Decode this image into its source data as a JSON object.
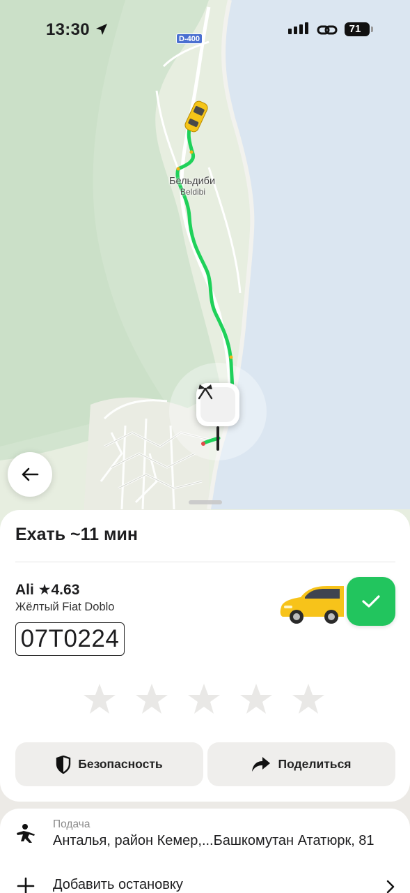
{
  "status_bar": {
    "time": "13:30",
    "battery": "71"
  },
  "map": {
    "road_badge": "D-400",
    "town_name_ru": "Бельдиби",
    "town_name_en": "Beldibi",
    "colors": {
      "land": "#e6eddf",
      "forest": "#cfe2cc",
      "sea": "#dbe6f1",
      "route": "#1fd15a"
    }
  },
  "trip": {
    "eta_title": "Ехать ~11 мин",
    "driver_line": "Ali ★4.63",
    "car_desc": "Жёлтый Fiat Doblo",
    "plate": "07T0224",
    "rating_stars": 5,
    "safety_label": "Безопасность",
    "share_label": "Поделиться"
  },
  "route": {
    "pickup_label": "Подача",
    "pickup_address": "Анталья, район Кемер,...Башкомутан Ататюрк, 81",
    "add_stop_label": "Добавить остановку"
  },
  "icons": {
    "location_arrow": "location-arrow-icon",
    "cellular": "signal-icon",
    "hotspot": "link-icon",
    "back": "arrow-left-icon",
    "finish": "finish-flags-icon",
    "check": "check-icon",
    "shield": "shield-icon",
    "share": "share-arrow-icon",
    "pickup": "walking-person-icon",
    "plus": "plus-icon",
    "chevron": "chevron-right-icon"
  }
}
